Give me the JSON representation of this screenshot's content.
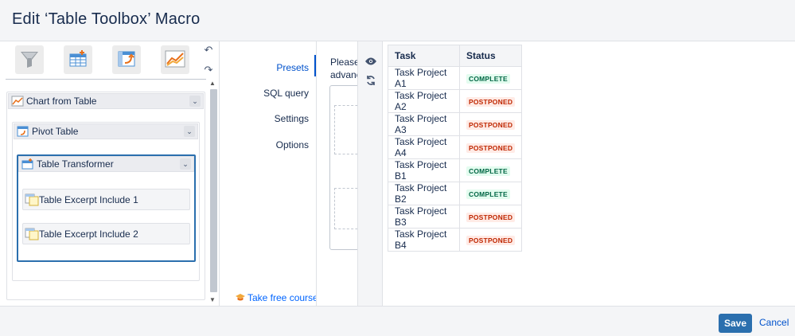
{
  "header": {
    "title": "Edit ‘Table Toolbox’ Macro"
  },
  "toolbar": {
    "buttons": [
      {
        "name": "filter-icon"
      },
      {
        "name": "table-transformer-icon"
      },
      {
        "name": "pivot-table-icon"
      },
      {
        "name": "chart-icon"
      }
    ],
    "undo_icon": "undo-icon",
    "redo_icon": "redo-icon"
  },
  "tree": {
    "chart": {
      "label": "Chart from Table"
    },
    "pivot": {
      "label": "Pivot Table"
    },
    "transformer": {
      "label": "Table Transformer"
    },
    "excerpt1": {
      "label": "Table Excerpt Include 1"
    },
    "excerpt2": {
      "label": "Table Excerpt Include 2"
    }
  },
  "nav": {
    "items": [
      "Presets",
      "SQL query",
      "Settings",
      "Options"
    ],
    "active": "Presets",
    "course_label": "Take free course"
  },
  "config": {
    "line1": "Please,",
    "line2": "advanc"
  },
  "table": {
    "headers": [
      "Task",
      "Status"
    ],
    "rows": [
      {
        "task": "Task Project A1",
        "status": "COMPLETE"
      },
      {
        "task": "Task Project A2",
        "status": "POSTPONED"
      },
      {
        "task": "Task Project A3",
        "status": "POSTPONED"
      },
      {
        "task": "Task Project A4",
        "status": "POSTPONED"
      },
      {
        "task": "Task Project B1",
        "status": "COMPLETE"
      },
      {
        "task": "Task Project B2",
        "status": "COMPLETE"
      },
      {
        "task": "Task Project B3",
        "status": "POSTPONED"
      },
      {
        "task": "Task Project B4",
        "status": "POSTPONED"
      }
    ]
  },
  "footer": {
    "save_label": "Save",
    "cancel_label": "Cancel"
  },
  "colors": {
    "accent": "#2b6fae",
    "link": "#0052cc",
    "complete_bg": "#e3fcef",
    "complete_fg": "#006644",
    "postponed_bg": "#ffebe6",
    "postponed_fg": "#bf2600"
  }
}
